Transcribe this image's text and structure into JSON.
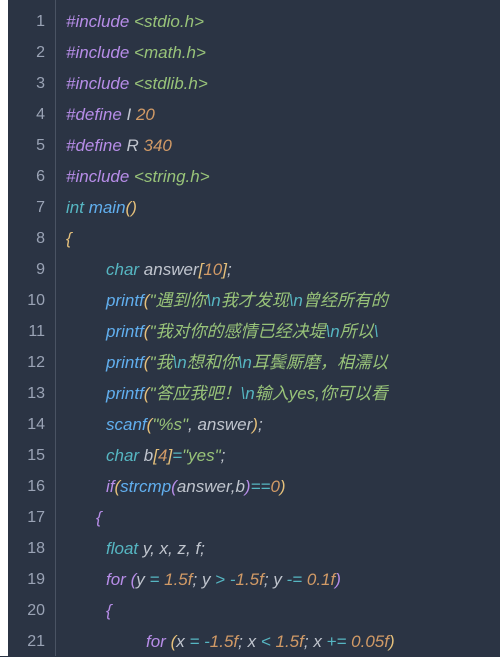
{
  "editor": {
    "lines": {
      "count": 21
    },
    "tokens": {
      "l1_preproc": "#include",
      "l1_path": " <stdio.h>",
      "l2_preproc": "#include",
      "l2_path": " <math.h>",
      "l3_preproc": "#include",
      "l3_path": " <stdlib.h>",
      "l4_preproc": "#define",
      "l4_name": " I ",
      "l4_val": "20",
      "l5_preproc": "#define",
      "l5_name": " R ",
      "l5_val": "340",
      "l6_preproc": "#include",
      "l6_path": " <string.h>",
      "l7_type": "int",
      "l7_func": " main",
      "l7_paren_open": "(",
      "l7_paren_close": ")",
      "l8_brace": "{",
      "l9_type": "char",
      "l9_ident": " answer",
      "l9_bracket_open": "[",
      "l9_num": "10",
      "l9_bracket_close": "]",
      "l9_semi": ";",
      "l10_func": "printf",
      "l10_paren_open": "(",
      "l10_str1": "\"遇到你",
      "l10_esc1": "\\n",
      "l10_str2": "我才发现",
      "l10_esc2": "\\n",
      "l10_str3": "曾经所有的",
      "l11_func": "printf",
      "l11_paren_open": "(",
      "l11_str1": "\"我对你的感情已经决堤",
      "l11_esc1": "\\n",
      "l11_str2": "所以",
      "l11_esc2": "\\",
      "l12_func": "printf",
      "l12_paren_open": "(",
      "l12_str1": "\"我",
      "l12_esc1": "\\n",
      "l12_str2": "想和你",
      "l12_esc2": "\\n",
      "l12_str3": "耳鬓厮磨，相濡以",
      "l13_func": "printf",
      "l13_paren_open": "(",
      "l13_str1": "\"答应我吧！",
      "l13_esc1": "\\n",
      "l13_str2": "输入yes,你可以看",
      "l14_func": "scanf",
      "l14_paren_open": "(",
      "l14_str": "\"%s\"",
      "l14_comma": ",",
      "l14_ident": " answer",
      "l14_paren_close": ")",
      "l14_semi": ";",
      "l15_type": "char",
      "l15_ident": " b",
      "l15_bracket_open": "[",
      "l15_num": "4",
      "l15_bracket_close": "]",
      "l15_op": "=",
      "l15_str": "\"yes\"",
      "l15_semi": ";",
      "l16_kw": "if",
      "l16_paren_open": "(",
      "l16_func": "strcmp",
      "l16_paren2_open": "(",
      "l16_arg1": "answer",
      "l16_comma": ",",
      "l16_arg2": "b",
      "l16_paren2_close": ")",
      "l16_op": "==",
      "l16_num": "0",
      "l16_paren_close": ")",
      "l17_brace": "{",
      "l18_type": "float",
      "l18_ids": " y, x, z, f",
      "l18_semi": ";",
      "l19_kw": "for ",
      "l19_paren_open": "(",
      "l19_v1": "y ",
      "l19_op1": "= ",
      "l19_n1": "1.5f",
      "l19_s1": "; ",
      "l19_v2": "y ",
      "l19_op2": "> ",
      "l19_op2b": "-",
      "l19_n2": "1.5f",
      "l19_s2": "; ",
      "l19_v3": "y ",
      "l19_op3": "-= ",
      "l19_n3": "0.1f",
      "l19_paren_close": ")",
      "l20_brace": "{",
      "l21_kw": "for ",
      "l21_paren_open": "(",
      "l21_v1": "x ",
      "l21_op1": "= ",
      "l21_op1b": "-",
      "l21_n1": "1.5f",
      "l21_s1": "; ",
      "l21_v2": "x ",
      "l21_op2": "< ",
      "l21_n2": "1.5f",
      "l21_s2": "; ",
      "l21_v3": "x ",
      "l21_op3": "+= ",
      "l21_n3": "0.05f",
      "l21_paren_close": ")"
    }
  },
  "line_numbers": [
    "1",
    "2",
    "3",
    "4",
    "5",
    "6",
    "7",
    "8",
    "9",
    "10",
    "11",
    "12",
    "13",
    "14",
    "15",
    "16",
    "17",
    "18",
    "19",
    "20",
    "21"
  ]
}
